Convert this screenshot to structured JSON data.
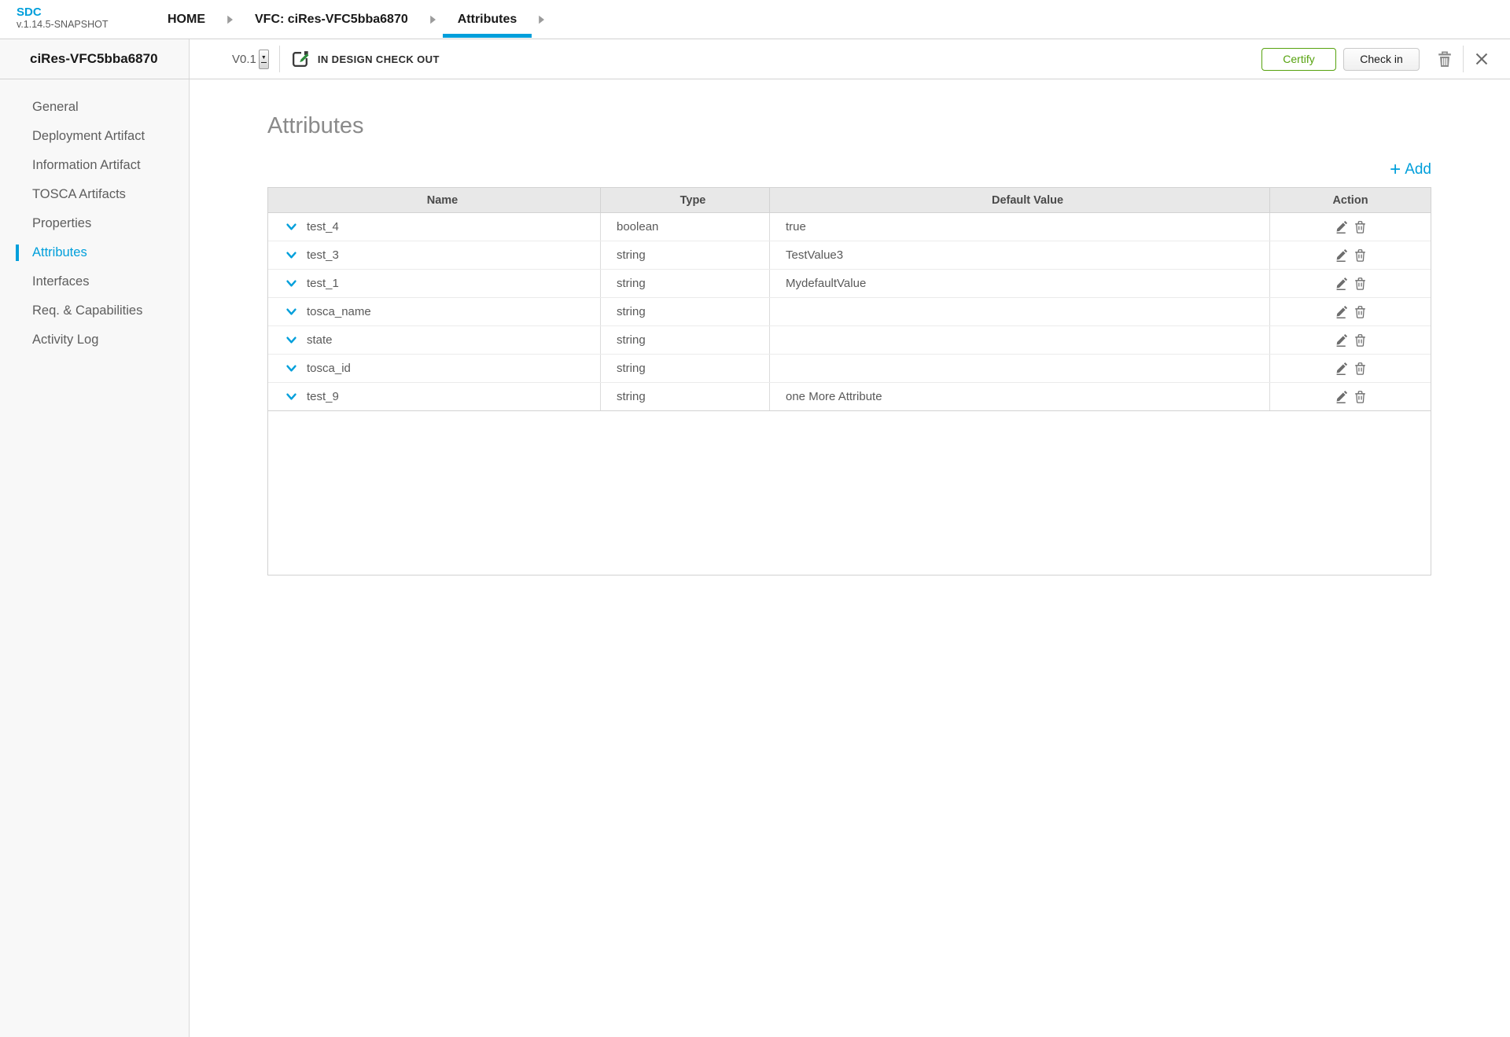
{
  "app": {
    "logo": {
      "title": "SDC",
      "version": "v.1.14.5-SNAPSHOT"
    },
    "breadcrumb": [
      {
        "label": "HOME",
        "active": false
      },
      {
        "label": "VFC: ciRes-VFC5bba6870",
        "active": false
      },
      {
        "label": "Attributes",
        "active": true
      }
    ]
  },
  "asset": {
    "name": "ciRes-VFC5bba6870",
    "version": "V0.1",
    "lifecycle_state": "IN DESIGN CHECK OUT",
    "actions": {
      "certify": "Certify",
      "check_in": "Check in"
    }
  },
  "sidebar": {
    "items": [
      {
        "label": "General",
        "active": false
      },
      {
        "label": "Deployment Artifact",
        "active": false
      },
      {
        "label": "Information Artifact",
        "active": false
      },
      {
        "label": "TOSCA Artifacts",
        "active": false
      },
      {
        "label": "Properties",
        "active": false
      },
      {
        "label": "Attributes",
        "active": true
      },
      {
        "label": "Interfaces",
        "active": false
      },
      {
        "label": "Req. & Capabilities",
        "active": false
      },
      {
        "label": "Activity Log",
        "active": false
      }
    ]
  },
  "main": {
    "title": "Attributes",
    "add_plus": "+",
    "add_label": "Add",
    "table": {
      "columns": [
        "Name",
        "Type",
        "Default Value",
        "Action"
      ],
      "rows": [
        {
          "name": "test_4",
          "type": "boolean",
          "default_value": "true"
        },
        {
          "name": "test_3",
          "type": "string",
          "default_value": "TestValue3"
        },
        {
          "name": "test_1",
          "type": "string",
          "default_value": "MydefaultValue"
        },
        {
          "name": "tosca_name",
          "type": "string",
          "default_value": ""
        },
        {
          "name": "state",
          "type": "string",
          "default_value": ""
        },
        {
          "name": "tosca_id",
          "type": "string",
          "default_value": ""
        },
        {
          "name": "test_9",
          "type": "string",
          "default_value": "one More Attribute"
        }
      ]
    }
  },
  "icons": {
    "breadcrumb_arrow": "triangle-right",
    "version_spinner_arrow": "▼",
    "checkout_state": "document-with-pencil",
    "delete": "trash",
    "close": "x",
    "expand_row": "chevron-down",
    "edit": "pencil"
  },
  "colors": {
    "accent_blue": "#009fdb",
    "certify_green": "#56a20e",
    "table_header_bg": "#e8e8e8",
    "border": "#d2d2d2"
  }
}
